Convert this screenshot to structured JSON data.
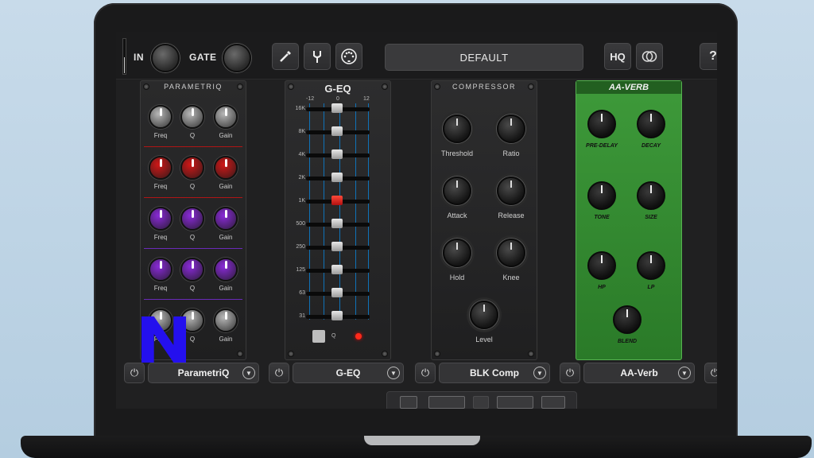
{
  "topbar": {
    "in_label": "IN",
    "gate_label": "GATE",
    "preset_name": "DEFAULT",
    "hq_label": "HQ",
    "help_label": "?",
    "icons": [
      "guitar-cable-icon",
      "tuning-fork-icon",
      "midi-icon",
      "compare-icon"
    ]
  },
  "modules": {
    "parametriq": {
      "panel_title": "PARAMETRIQ",
      "knob_labels": [
        "Freq",
        "Q",
        "Gain"
      ],
      "bands": [
        {
          "color": "#b8b8b8"
        },
        {
          "color": "#d01818"
        },
        {
          "color": "#8a2ad8"
        },
        {
          "color": "#8a2ad8"
        },
        {
          "color": "#b8b8b8"
        }
      ],
      "slot_name": "ParametriQ"
    },
    "geq": {
      "panel_title": "G-EQ",
      "scale": [
        "-12",
        "0",
        "12"
      ],
      "bands": [
        "16K",
        "8K",
        "4K",
        "2K",
        "1K",
        "500",
        "250",
        "125",
        "63",
        "31"
      ],
      "q_label": "Q",
      "slot_name": "G-EQ"
    },
    "compressor": {
      "panel_title": "COMPRESSOR",
      "knobs": [
        "Threshold",
        "Ratio",
        "Attack",
        "Release",
        "Hold",
        "Knee",
        "Level"
      ],
      "slot_name": "BLK Comp"
    },
    "reverb": {
      "panel_title": "AA-VERB",
      "knobs": [
        "PRE-DELAY",
        "DECAY",
        "TONE",
        "SIZE",
        "HP",
        "LP",
        "BLEND"
      ],
      "slot_name": "AA-Verb"
    }
  },
  "overlay_logo": "N",
  "colors": {
    "verb_green": "#3e9a3a",
    "geq_line": "#0f72b8",
    "logo_blue": "#2410ee"
  }
}
